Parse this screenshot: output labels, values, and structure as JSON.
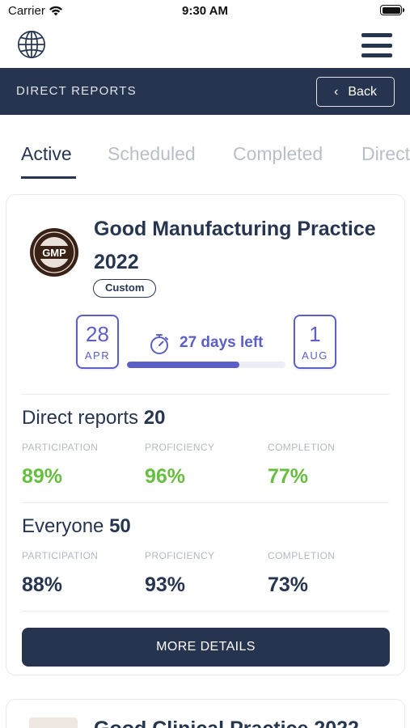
{
  "status_bar": {
    "carrier": "Carrier",
    "time": "9:30 AM"
  },
  "header": {
    "globe_icon": "globe-icon",
    "menu_icon": "hamburger-menu-icon"
  },
  "nav": {
    "title": "DIRECT REPORTS",
    "back_label": "Back"
  },
  "tabs": [
    {
      "label": "Active",
      "active": true
    },
    {
      "label": "Scheduled",
      "active": false
    },
    {
      "label": "Completed",
      "active": false
    },
    {
      "label": "Direct",
      "active": false
    }
  ],
  "card": {
    "logo_text": "GMP",
    "title": "Good Manufacturing Practice 2022",
    "tag": "Custom",
    "start_day": "28",
    "start_month": "APR",
    "end_day": "1",
    "end_month": "AUG",
    "days_left": "27 days left",
    "progress_fraction": 0.71,
    "accent_color": "#5b5fc7",
    "direct_reports": {
      "label": "Direct reports",
      "count": "20",
      "participation_label": "PARTICIPATION",
      "participation": "89%",
      "proficiency_label": "PROFICIENCY",
      "proficiency": "96%",
      "completion_label": "COMPLETION",
      "completion": "77%"
    },
    "everyone": {
      "label": "Everyone",
      "count": "50",
      "participation_label": "PARTICIPATION",
      "participation": "88%",
      "proficiency_label": "PROFICIENCY",
      "proficiency": "93%",
      "completion_label": "COMPLETION",
      "completion": "73%"
    },
    "more_details_label": "MORE DETAILS"
  },
  "next_card": {
    "title": "Good Clinical Practice 2022"
  }
}
